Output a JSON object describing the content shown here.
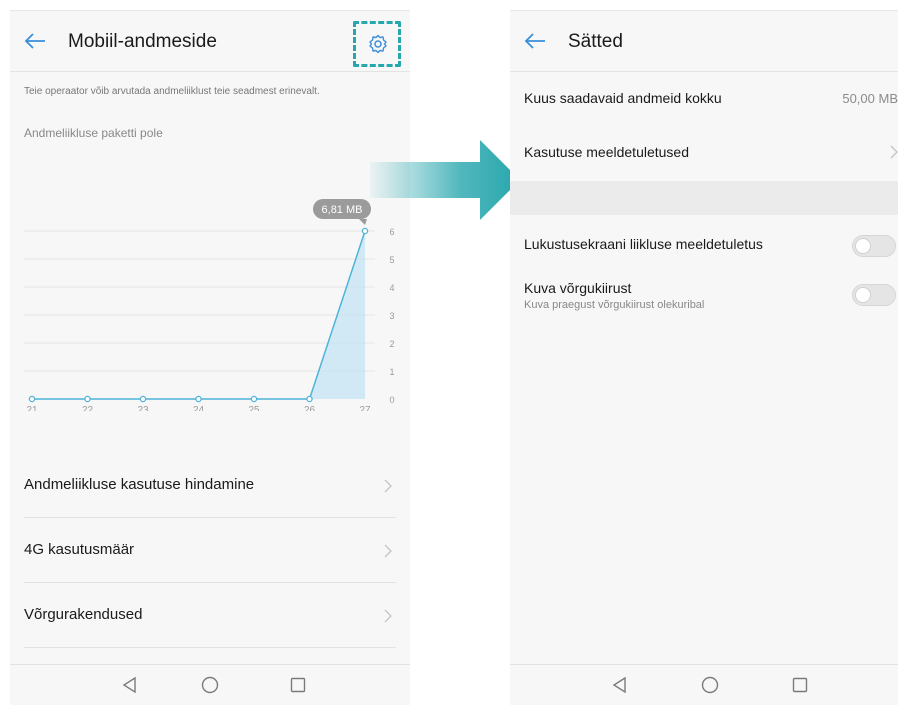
{
  "colors": {
    "accent": "#26a6ad",
    "chart_line": "#4fb4d8",
    "chart_fill": "#bfe3f2"
  },
  "left_screen": {
    "title": "Mobiil-andmeside",
    "notice": "Teie operaator võib arvutada andmeliiklust teie seadmest erinevalt.",
    "package_status": "Andmeliikluse paketti pole",
    "usage_badge": "6,81 MB",
    "menu_items": [
      {
        "label": "Andmeliikluse kasutuse hindamine"
      },
      {
        "label": "4G kasutusmäär"
      },
      {
        "label": "Võrgurakendused"
      }
    ]
  },
  "chart_data": {
    "type": "area",
    "x": [
      "21",
      "22",
      "23",
      "24",
      "25",
      "26",
      "27"
    ],
    "series": [
      {
        "values": [
          0,
          0,
          0,
          0,
          0,
          0,
          6
        ]
      }
    ],
    "y_ticks": [
      "0",
      "1",
      "2",
      "3",
      "4",
      "5",
      "6"
    ],
    "ylim": [
      0,
      6
    ],
    "grid": true,
    "annotation": "6,81 MB"
  },
  "right_screen": {
    "title": "Sätted",
    "monthly_data_label": "Kuus saadavaid andmeid kokku",
    "monthly_data_value": "50,00 MB",
    "usage_reminders_label": "Kasutuse meeldetuletused",
    "lockscreen_reminder_label": "Lukustusekraani liikluse meeldetuletus",
    "lockscreen_reminder_on": false,
    "network_speed_label": "Kuva võrgukiirust",
    "network_speed_sub": "Kuva praegust võrgukiirust olekuribal",
    "network_speed_on": false
  },
  "icons": {
    "back": "back-arrow-icon",
    "settings": "gear-icon",
    "chevron": "chevron-right-icon",
    "nav_back": "triangle-back-icon",
    "nav_home": "circle-home-icon",
    "nav_recent": "square-recent-icon"
  }
}
